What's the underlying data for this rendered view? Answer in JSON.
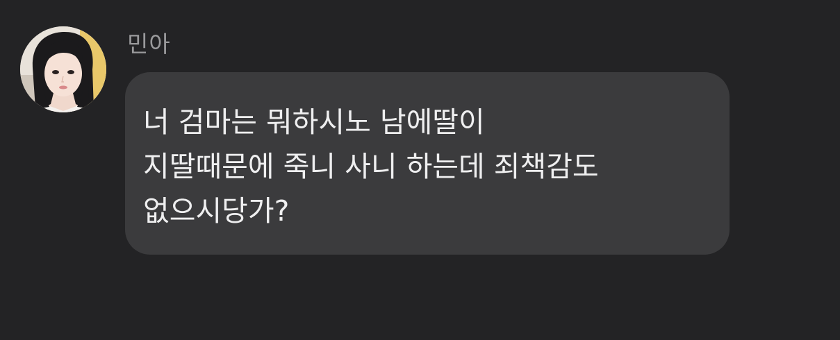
{
  "message": {
    "sender_name": "민아",
    "avatar_icon": "profile-photo",
    "lines": [
      "너 검마는 뭐하시노 남에딸이",
      "지딸때문에 죽니 사니 하는데 죄책감도",
      "없으시당가?"
    ]
  },
  "colors": {
    "background": "#232325",
    "bubble": "#3b3b3d",
    "message_text": "#efeff0",
    "sender_text": "#9a9a9c"
  }
}
